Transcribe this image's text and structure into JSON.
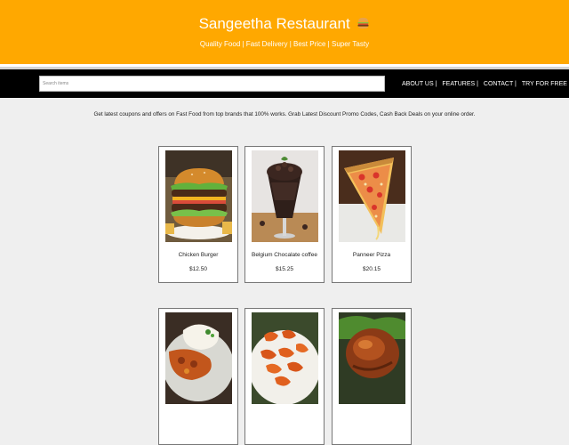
{
  "header": {
    "title": "Sangeetha Restaurant",
    "tagline": "Quality Food | Fast Delivery | Best Price | Super Tasty",
    "accent_color": "#ffa800"
  },
  "navbar": {
    "search_placeholder": "Search items",
    "links": [
      "ABOUT US |",
      "FEATURES |",
      "CONTACT |",
      "TRY FOR FREE"
    ]
  },
  "intro_text": "Get latest coupons and offers on Fast Food from top brands that 100% works. Grab Latest Discount Promo Codes, Cash Back Deals on your online order.",
  "products": [
    {
      "name": "Chicken Burger",
      "price": "$12.50",
      "image_icon": "burger-photo"
    },
    {
      "name": "Belgium Chocalate coffee",
      "price": "$15.25",
      "image_icon": "chocolate-coffee-photo"
    },
    {
      "name": "Panneer Pizza",
      "price": "$20.15",
      "image_icon": "pizza-photo"
    },
    {
      "name": "",
      "price": "",
      "image_icon": "curry-rice-photo"
    },
    {
      "name": "",
      "price": "",
      "image_icon": "fried-shrimp-photo"
    },
    {
      "name": "",
      "price": "",
      "image_icon": "roast-chicken-photo"
    }
  ]
}
